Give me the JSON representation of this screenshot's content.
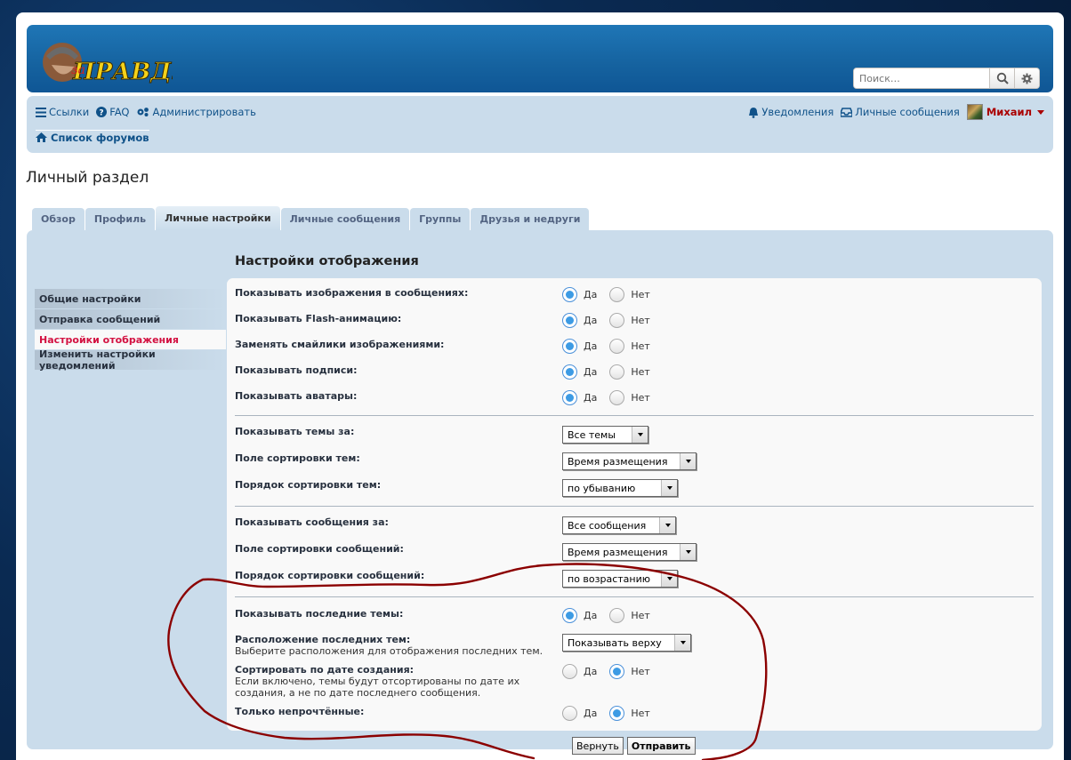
{
  "header": {
    "logo_text": "ЗА ПРАВДУ!",
    "search_placeholder": "Поиск…",
    "search_icon": "search-icon",
    "advanced_search_icon": "gear-icon"
  },
  "nav": {
    "links": "Ссылки",
    "faq": "FAQ",
    "admin": "Администрировать",
    "notifications": "Уведомления",
    "messages": "Личные сообщения",
    "username": "Михаил",
    "breadcrumb": "Список форумов"
  },
  "page_title": "Личный раздел",
  "tabs": [
    "Обзор",
    "Профиль",
    "Личные настройки",
    "Личные сообщения",
    "Группы",
    "Друзья и недруги"
  ],
  "sidebar": [
    "Общие настройки",
    "Отправка сообщений",
    "Настройки отображения",
    "Изменить настройки уведомлений"
  ],
  "section_title": "Настройки отображения",
  "radio_labels": {
    "yes": "Да",
    "no": "Нет"
  },
  "group1": [
    {
      "label": "Показывать изображения в сообщениях:",
      "value": "Да"
    },
    {
      "label": "Показывать Flash-анимацию:",
      "value": "Да"
    },
    {
      "label": "Заменять смайлики изображениями:",
      "value": "Да"
    },
    {
      "label": "Показывать подписи:",
      "value": "Да"
    },
    {
      "label": "Показывать аватары:",
      "value": "Да"
    }
  ],
  "group2": [
    {
      "label": "Показывать темы за:",
      "value": "Все темы"
    },
    {
      "label": "Поле сортировки тем:",
      "value": "Время размещения"
    },
    {
      "label": "Порядок сортировки тем:",
      "value": "по убыванию"
    }
  ],
  "group3": [
    {
      "label": "Показывать сообщения за:",
      "value": "Все сообщения"
    },
    {
      "label": "Поле сортировки сообщений:",
      "value": "Время размещения"
    },
    {
      "label": "Порядок сортировки сообщений:",
      "value": "по возрастанию"
    }
  ],
  "group4": {
    "show_recent": {
      "label": "Показывать последние темы:",
      "value": "Да"
    },
    "recent_position": {
      "label": "Расположение последних тем:",
      "desc": "Выберите расположения для отображения последних тем.",
      "value": "Показывать верху"
    },
    "sort_by_date": {
      "label": "Сортировать по дате создания:",
      "desc": "Если включено, темы будут отсортированы по дате их создания, а не по дате последнего сообщения.",
      "value": "Нет"
    },
    "unread_only": {
      "label": "Только непрочтённые:",
      "value": "Нет"
    }
  },
  "buttons": {
    "reset": "Вернуть",
    "submit": "Отправить"
  },
  "colors": {
    "accent": "#105289",
    "panel": "#cadceb",
    "active_menu": "#d31141",
    "annotation": "#8b0000"
  }
}
